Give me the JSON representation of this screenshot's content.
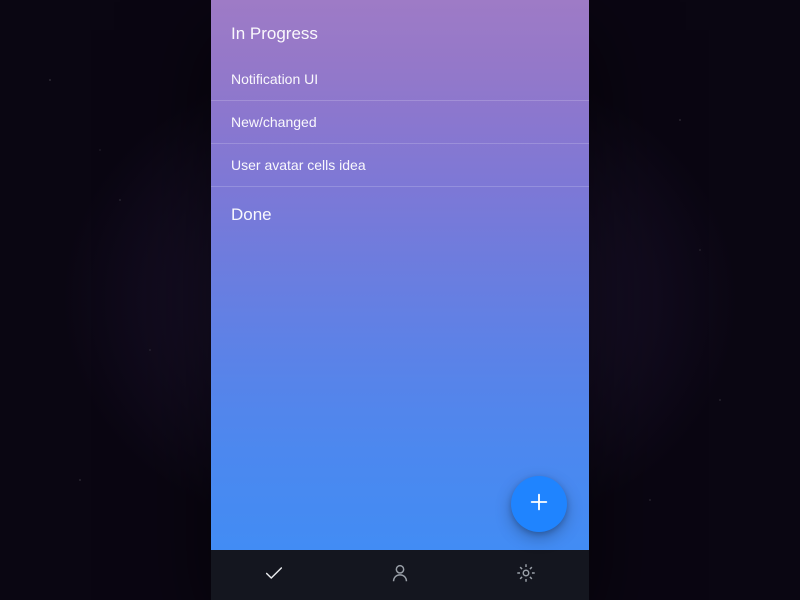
{
  "sections": {
    "in_progress": {
      "title": "In Progress",
      "items": [
        {
          "label": "Notification UI"
        },
        {
          "label": "New/changed"
        },
        {
          "label": "User avatar cells idea"
        }
      ]
    },
    "done": {
      "title": "Done",
      "items": []
    }
  },
  "fab": {
    "icon": "plus"
  },
  "tabs": [
    {
      "name": "tasks",
      "icon": "checkmark",
      "active": true
    },
    {
      "name": "profile",
      "icon": "person",
      "active": false
    },
    {
      "name": "settings",
      "icon": "gear",
      "active": false
    }
  ],
  "colors": {
    "fab": "#1f84ff",
    "tabbar": "#14161f"
  }
}
